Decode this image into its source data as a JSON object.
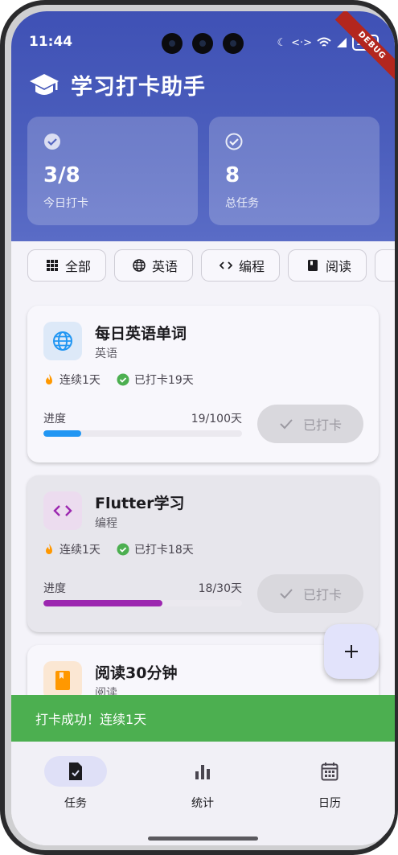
{
  "status_bar": {
    "time": "11:44",
    "battery": "100",
    "debug_banner": "DEBUG"
  },
  "header": {
    "title": "学习打卡助手",
    "icon": "graduation-cap-icon"
  },
  "stats": [
    {
      "value": "3/8",
      "label": "今日打卡",
      "icon": "check-circle-icon"
    },
    {
      "value": "8",
      "label": "总任务",
      "icon": "check-circle-outline-icon"
    }
  ],
  "filters": [
    {
      "label": "全部",
      "icon": "grid-icon"
    },
    {
      "label": "英语",
      "icon": "globe-icon"
    },
    {
      "label": "编程",
      "icon": "code-icon"
    },
    {
      "label": "阅读",
      "icon": "book-icon"
    }
  ],
  "tasks": [
    {
      "name": "每日英语单词",
      "category": "英语",
      "streak": "连续1天",
      "checked": "已打卡19天",
      "progress_label": "进度",
      "progress_text": "19/100天",
      "progress": 0.19,
      "button": "已打卡",
      "accent": "#2196f3",
      "icon_bg": "#dde9f8"
    },
    {
      "name": "Flutter学习",
      "category": "编程",
      "streak": "连续1天",
      "checked": "已打卡18天",
      "progress_label": "进度",
      "progress_text": "18/30天",
      "progress": 0.6,
      "button": "已打卡",
      "accent": "#9c27b0",
      "icon_bg": "#ecdcef"
    },
    {
      "name": "阅读30分钟",
      "category": "阅读",
      "accent": "#ff9800",
      "icon_bg": "#fbe7d3"
    }
  ],
  "snackbar": {
    "message": "打卡成功！连续1天"
  },
  "nav": [
    {
      "label": "任务",
      "icon": "task-icon"
    },
    {
      "label": "统计",
      "icon": "bar-chart-icon"
    },
    {
      "label": "日历",
      "icon": "calendar-icon"
    }
  ]
}
